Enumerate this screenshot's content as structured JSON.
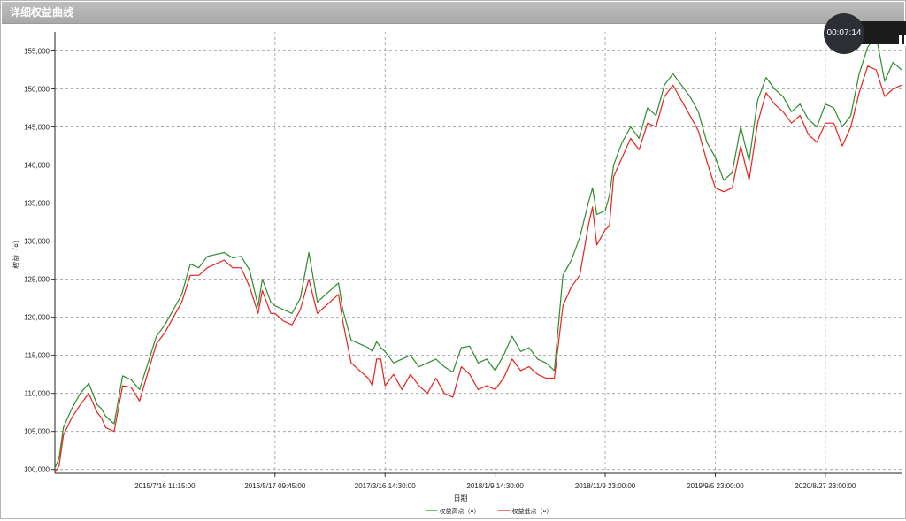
{
  "window": {
    "title": "详细权益曲线"
  },
  "recorder": {
    "time": "00:07:14"
  },
  "chart_data": {
    "type": "line",
    "title": "",
    "xlabel": "日期",
    "ylabel": "权益（¤）",
    "ylim": [
      99500,
      157500
    ],
    "grid": true,
    "legend_position": "bottom-center",
    "y_ticks": [
      100000,
      105000,
      110000,
      115000,
      120000,
      125000,
      130000,
      135000,
      140000,
      145000,
      150000,
      155000
    ],
    "y_tick_labels": [
      "100,000",
      "105,000",
      "110,000",
      "115,000",
      "120,000",
      "125,000",
      "130,000",
      "135,000",
      "140,000",
      "145,000",
      "150,000",
      "155,000"
    ],
    "x_tick_labels": [
      "2015/7/16 11:15:00",
      "2016/5/17 09:45:00",
      "2017/3/16 14:30:00",
      "2018/1/9 14:30:00",
      "2018/11/9 23:00:00",
      "2019/9/5 23:00:00",
      "2020/8/27 23:00:00"
    ],
    "x_tick_positions": [
      0.13,
      0.26,
      0.39,
      0.52,
      0.65,
      0.78,
      0.91
    ],
    "x_range": [
      0,
      1
    ],
    "series": [
      {
        "name": "权益高点（¤）",
        "color": "#2e8b2e",
        "x": [
          0,
          0.005,
          0.01,
          0.02,
          0.03,
          0.04,
          0.05,
          0.055,
          0.06,
          0.07,
          0.08,
          0.09,
          0.1,
          0.11,
          0.12,
          0.13,
          0.14,
          0.15,
          0.16,
          0.17,
          0.18,
          0.2,
          0.21,
          0.22,
          0.23,
          0.24,
          0.245,
          0.25,
          0.255,
          0.26,
          0.27,
          0.28,
          0.29,
          0.3,
          0.31,
          0.335,
          0.34,
          0.35,
          0.36,
          0.37,
          0.375,
          0.38,
          0.385,
          0.39,
          0.4,
          0.41,
          0.42,
          0.43,
          0.44,
          0.45,
          0.46,
          0.47,
          0.48,
          0.49,
          0.5,
          0.51,
          0.52,
          0.53,
          0.54,
          0.55,
          0.56,
          0.57,
          0.58,
          0.59,
          0.6,
          0.61,
          0.62,
          0.63,
          0.635,
          0.64,
          0.65,
          0.655,
          0.66,
          0.67,
          0.68,
          0.69,
          0.7,
          0.71,
          0.72,
          0.73,
          0.74,
          0.75,
          0.76,
          0.77,
          0.78,
          0.79,
          0.8,
          0.81,
          0.82,
          0.83,
          0.84,
          0.85,
          0.86,
          0.87,
          0.88,
          0.89,
          0.9,
          0.91,
          0.92,
          0.93,
          0.94,
          0.95,
          0.96,
          0.97,
          0.98,
          0.99,
          1.0
        ],
        "values": [
          100200,
          101500,
          105500,
          108000,
          110000,
          111300,
          108500,
          108000,
          107000,
          106000,
          112300,
          111800,
          110500,
          114000,
          117500,
          119000,
          121000,
          123000,
          127000,
          126500,
          128000,
          128500,
          127800,
          128000,
          126200,
          121500,
          125000,
          123500,
          122000,
          121500,
          121000,
          120500,
          122500,
          128500,
          122000,
          124500,
          121000,
          117000,
          116500,
          116000,
          115500,
          116800,
          116000,
          115500,
          114000,
          114500,
          115000,
          113500,
          114000,
          114500,
          113500,
          112800,
          116000,
          116200,
          114000,
          114500,
          113000,
          115000,
          117500,
          115500,
          116000,
          114500,
          114000,
          113000,
          125500,
          127500,
          130500,
          135000,
          137000,
          133500,
          134000,
          136000,
          140000,
          143000,
          145000,
          143500,
          147500,
          146500,
          150500,
          152000,
          150500,
          149000,
          147000,
          143000,
          141000,
          138000,
          139000,
          145000,
          140500,
          148500,
          151500,
          150000,
          149000,
          147000,
          148000,
          146000,
          145000,
          148000,
          147500,
          145000,
          146500,
          152000,
          155500,
          157000,
          151000,
          153500,
          152500
        ]
      },
      {
        "name": "权益低点（¤）",
        "color": "#e8231c",
        "x": [
          0,
          0.005,
          0.01,
          0.02,
          0.03,
          0.04,
          0.05,
          0.055,
          0.06,
          0.07,
          0.08,
          0.09,
          0.1,
          0.11,
          0.12,
          0.13,
          0.14,
          0.15,
          0.16,
          0.17,
          0.18,
          0.2,
          0.21,
          0.22,
          0.23,
          0.24,
          0.245,
          0.25,
          0.255,
          0.26,
          0.27,
          0.28,
          0.29,
          0.3,
          0.31,
          0.335,
          0.34,
          0.35,
          0.36,
          0.37,
          0.375,
          0.38,
          0.385,
          0.39,
          0.4,
          0.41,
          0.42,
          0.43,
          0.44,
          0.45,
          0.46,
          0.47,
          0.48,
          0.49,
          0.5,
          0.51,
          0.52,
          0.53,
          0.54,
          0.55,
          0.56,
          0.57,
          0.58,
          0.59,
          0.6,
          0.61,
          0.62,
          0.63,
          0.635,
          0.64,
          0.65,
          0.655,
          0.66,
          0.67,
          0.68,
          0.69,
          0.7,
          0.71,
          0.72,
          0.73,
          0.74,
          0.75,
          0.76,
          0.77,
          0.78,
          0.79,
          0.8,
          0.81,
          0.82,
          0.83,
          0.84,
          0.85,
          0.86,
          0.87,
          0.88,
          0.89,
          0.9,
          0.91,
          0.92,
          0.93,
          0.94,
          0.95,
          0.96,
          0.97,
          0.98,
          0.99,
          1.0
        ],
        "values": [
          99600,
          100500,
          104500,
          106800,
          108500,
          110000,
          107500,
          106800,
          105500,
          105000,
          111000,
          110800,
          109000,
          112800,
          116500,
          118000,
          120000,
          122000,
          125500,
          125500,
          126500,
          127500,
          126500,
          126500,
          124000,
          120500,
          123500,
          122000,
          120500,
          120500,
          119500,
          119000,
          121000,
          125000,
          120500,
          123000,
          119500,
          114000,
          113000,
          112000,
          111000,
          114500,
          114500,
          111000,
          112500,
          110500,
          112500,
          111000,
          110000,
          112000,
          110000,
          109500,
          113500,
          112500,
          110500,
          111000,
          110500,
          112000,
          114500,
          113000,
          113500,
          112500,
          112000,
          112000,
          121500,
          124000,
          125500,
          132000,
          134500,
          129500,
          131500,
          132000,
          138500,
          141000,
          143500,
          142000,
          145500,
          145000,
          149000,
          150500,
          148500,
          146500,
          144500,
          140500,
          137000,
          136500,
          137000,
          142500,
          138000,
          145500,
          149500,
          148000,
          147000,
          145500,
          146500,
          144000,
          143000,
          145500,
          145500,
          142500,
          145000,
          149500,
          153000,
          152500,
          149000,
          150000,
          150500
        ]
      }
    ]
  }
}
